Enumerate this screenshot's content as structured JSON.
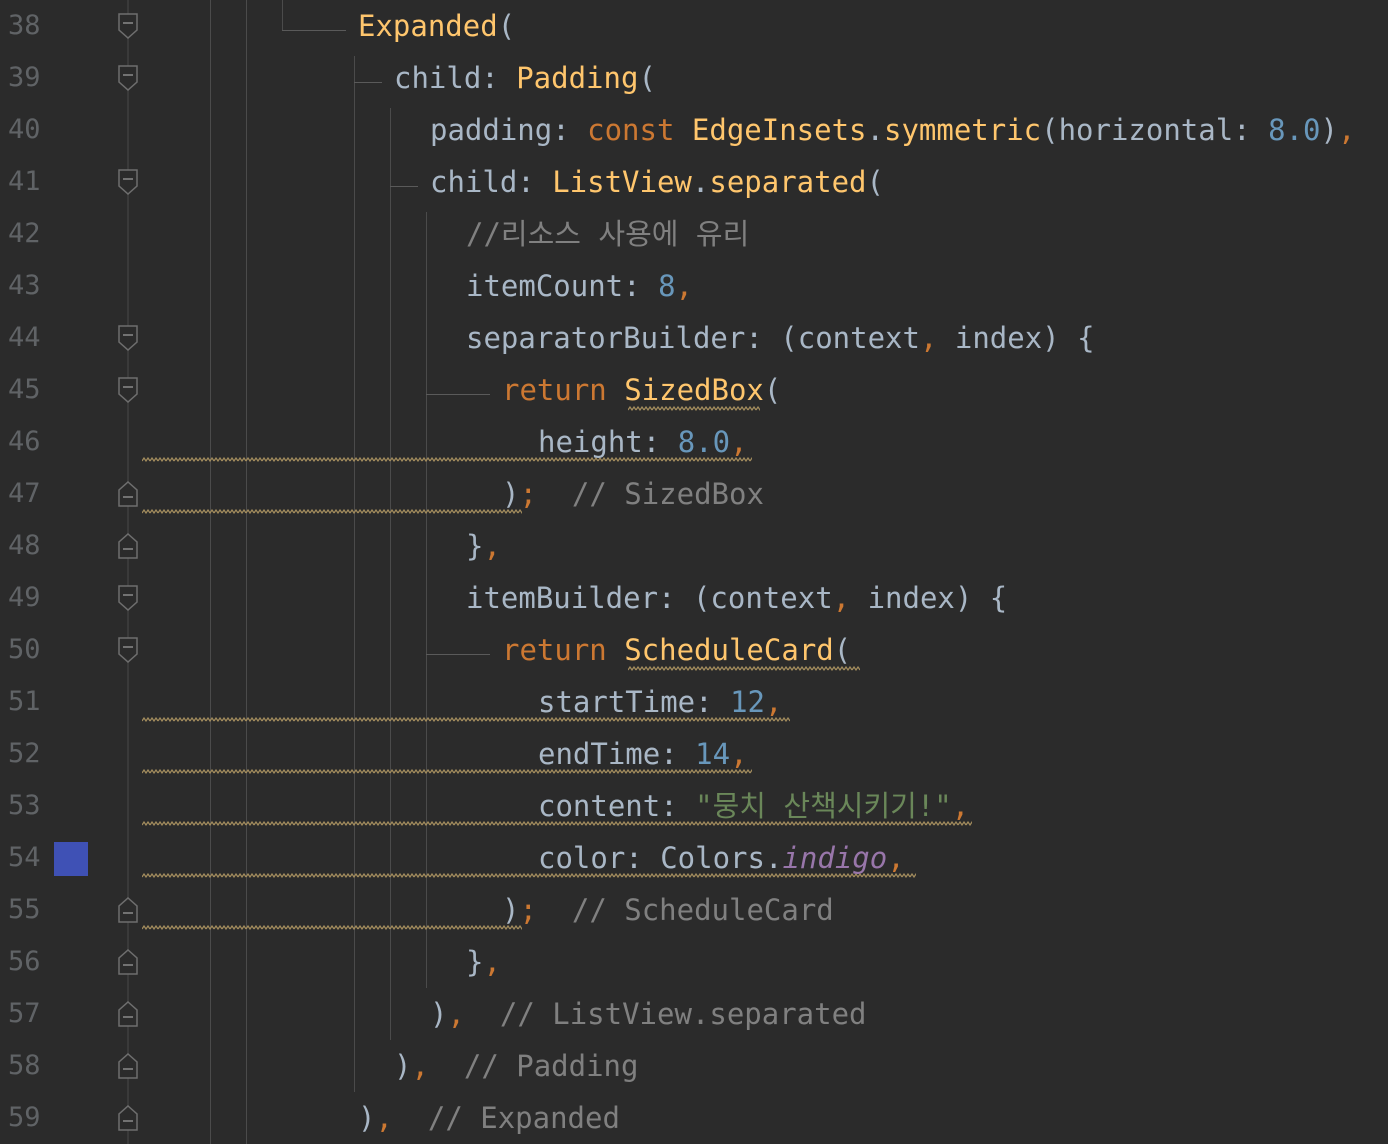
{
  "editor": {
    "colors": {
      "background": "#2b2b2b",
      "keyword": "#cc7832",
      "class": "#ffc66d",
      "number": "#6897bb",
      "string": "#6a8759",
      "comment": "#808080",
      "field": "#9876aa",
      "plain": "#a9b7c6",
      "line_number": "#606366",
      "color_swatch": "#3f51b5"
    },
    "lines": [
      {
        "num": "38",
        "indent": 10,
        "fold": "open",
        "tokens": [
          {
            "t": "Expanded",
            "c": "cls"
          },
          {
            "t": "(",
            "c": "p"
          }
        ]
      },
      {
        "num": "39",
        "indent": 11,
        "fold": "open",
        "tokens": [
          {
            "t": "child: ",
            "c": "p"
          },
          {
            "t": "Padding",
            "c": "cls"
          },
          {
            "t": "(",
            "c": "p"
          }
        ]
      },
      {
        "num": "40",
        "indent": 12,
        "fold": "none",
        "tokens": [
          {
            "t": "padding: ",
            "c": "p"
          },
          {
            "t": "const ",
            "c": "kw"
          },
          {
            "t": "EdgeInsets",
            "c": "cls"
          },
          {
            "t": ".",
            "c": "p"
          },
          {
            "t": "symmetric",
            "c": "cls"
          },
          {
            "t": "(horizontal: ",
            "c": "p"
          },
          {
            "t": "8.0",
            "c": "num"
          },
          {
            "t": ")",
            "c": "p"
          },
          {
            "t": ",",
            "c": "com"
          }
        ]
      },
      {
        "num": "41",
        "indent": 12,
        "fold": "open",
        "tokens": [
          {
            "t": "child: ",
            "c": "p"
          },
          {
            "t": "ListView",
            "c": "cls"
          },
          {
            "t": ".",
            "c": "p"
          },
          {
            "t": "separated",
            "c": "cls"
          },
          {
            "t": "(",
            "c": "p"
          }
        ]
      },
      {
        "num": "42",
        "indent": 13,
        "fold": "none",
        "tokens": [
          {
            "t": "//리소스 사용에 유리",
            "c": "cmt"
          }
        ]
      },
      {
        "num": "43",
        "indent": 13,
        "fold": "none",
        "tokens": [
          {
            "t": "itemCount: ",
            "c": "p"
          },
          {
            "t": "8",
            "c": "num"
          },
          {
            "t": ",",
            "c": "com"
          }
        ]
      },
      {
        "num": "44",
        "indent": 13,
        "fold": "open",
        "tokens": [
          {
            "t": "separatorBuilder: (context",
            "c": "p"
          },
          {
            "t": ", ",
            "c": "com"
          },
          {
            "t": "index) {",
            "c": "p"
          }
        ]
      },
      {
        "num": "45",
        "indent": 14,
        "fold": "open",
        "tokens": [
          {
            "t": "return ",
            "c": "kw"
          },
          {
            "t": "SizedBox",
            "c": "cls"
          },
          {
            "t": "(",
            "c": "p"
          }
        ]
      },
      {
        "num": "46",
        "indent": 15,
        "fold": "none",
        "tokens": [
          {
            "t": "height: ",
            "c": "p"
          },
          {
            "t": "8.0",
            "c": "num"
          },
          {
            "t": ",",
            "c": "com"
          }
        ]
      },
      {
        "num": "47",
        "indent": 14,
        "fold": "close",
        "tokens": [
          {
            "t": ")",
            "c": "p"
          },
          {
            "t": ";",
            "c": "com"
          },
          {
            "t": "  // SizedBox",
            "c": "cmt"
          }
        ]
      },
      {
        "num": "48",
        "indent": 13,
        "fold": "close",
        "tokens": [
          {
            "t": "}",
            "c": "p"
          },
          {
            "t": ",",
            "c": "com"
          }
        ]
      },
      {
        "num": "49",
        "indent": 13,
        "fold": "open",
        "tokens": [
          {
            "t": "itemBuilder: (context",
            "c": "p"
          },
          {
            "t": ", ",
            "c": "com"
          },
          {
            "t": "index) {",
            "c": "p"
          }
        ]
      },
      {
        "num": "50",
        "indent": 14,
        "fold": "open",
        "tokens": [
          {
            "t": "return ",
            "c": "kw"
          },
          {
            "t": "ScheduleCard",
            "c": "cls"
          },
          {
            "t": "(",
            "c": "p"
          }
        ]
      },
      {
        "num": "51",
        "indent": 15,
        "fold": "none",
        "tokens": [
          {
            "t": "startTime: ",
            "c": "p"
          },
          {
            "t": "12",
            "c": "num"
          },
          {
            "t": ",",
            "c": "com"
          }
        ]
      },
      {
        "num": "52",
        "indent": 15,
        "fold": "none",
        "tokens": [
          {
            "t": "endTime: ",
            "c": "p"
          },
          {
            "t": "14",
            "c": "num"
          },
          {
            "t": ",",
            "c": "com"
          }
        ]
      },
      {
        "num": "53",
        "indent": 15,
        "fold": "none",
        "tokens": [
          {
            "t": "content: ",
            "c": "p"
          },
          {
            "t": "\"뭉치 산책시키기!\"",
            "c": "str"
          },
          {
            "t": ",",
            "c": "com"
          }
        ]
      },
      {
        "num": "54",
        "indent": 15,
        "fold": "none",
        "tokens": [
          {
            "t": "color: ",
            "c": "p"
          },
          {
            "t": "Colors",
            "c": "p"
          },
          {
            "t": ".",
            "c": "p"
          },
          {
            "t": "indigo",
            "c": "fld"
          },
          {
            "t": ",",
            "c": "com"
          }
        ]
      },
      {
        "num": "55",
        "indent": 14,
        "fold": "close",
        "tokens": [
          {
            "t": ")",
            "c": "p"
          },
          {
            "t": ";",
            "c": "com"
          },
          {
            "t": "  // ScheduleCard",
            "c": "cmt"
          }
        ]
      },
      {
        "num": "56",
        "indent": 13,
        "fold": "close",
        "tokens": [
          {
            "t": "}",
            "c": "p"
          },
          {
            "t": ",",
            "c": "com"
          }
        ]
      },
      {
        "num": "57",
        "indent": 12,
        "fold": "close",
        "tokens": [
          {
            "t": ")",
            "c": "p"
          },
          {
            "t": ",",
            "c": "com"
          },
          {
            "t": "  // ListView.separated",
            "c": "cmt"
          }
        ]
      },
      {
        "num": "58",
        "indent": 11,
        "fold": "close",
        "tokens": [
          {
            "t": ")",
            "c": "p"
          },
          {
            "t": ",",
            "c": "com"
          },
          {
            "t": "  // Padding",
            "c": "cmt"
          }
        ]
      },
      {
        "num": "59",
        "indent": 10,
        "fold": "close",
        "tokens": [
          {
            "t": ")",
            "c": "p"
          },
          {
            "t": ",",
            "c": "com"
          },
          {
            "t": "  // Expanded",
            "c": "cmt"
          }
        ]
      }
    ]
  }
}
